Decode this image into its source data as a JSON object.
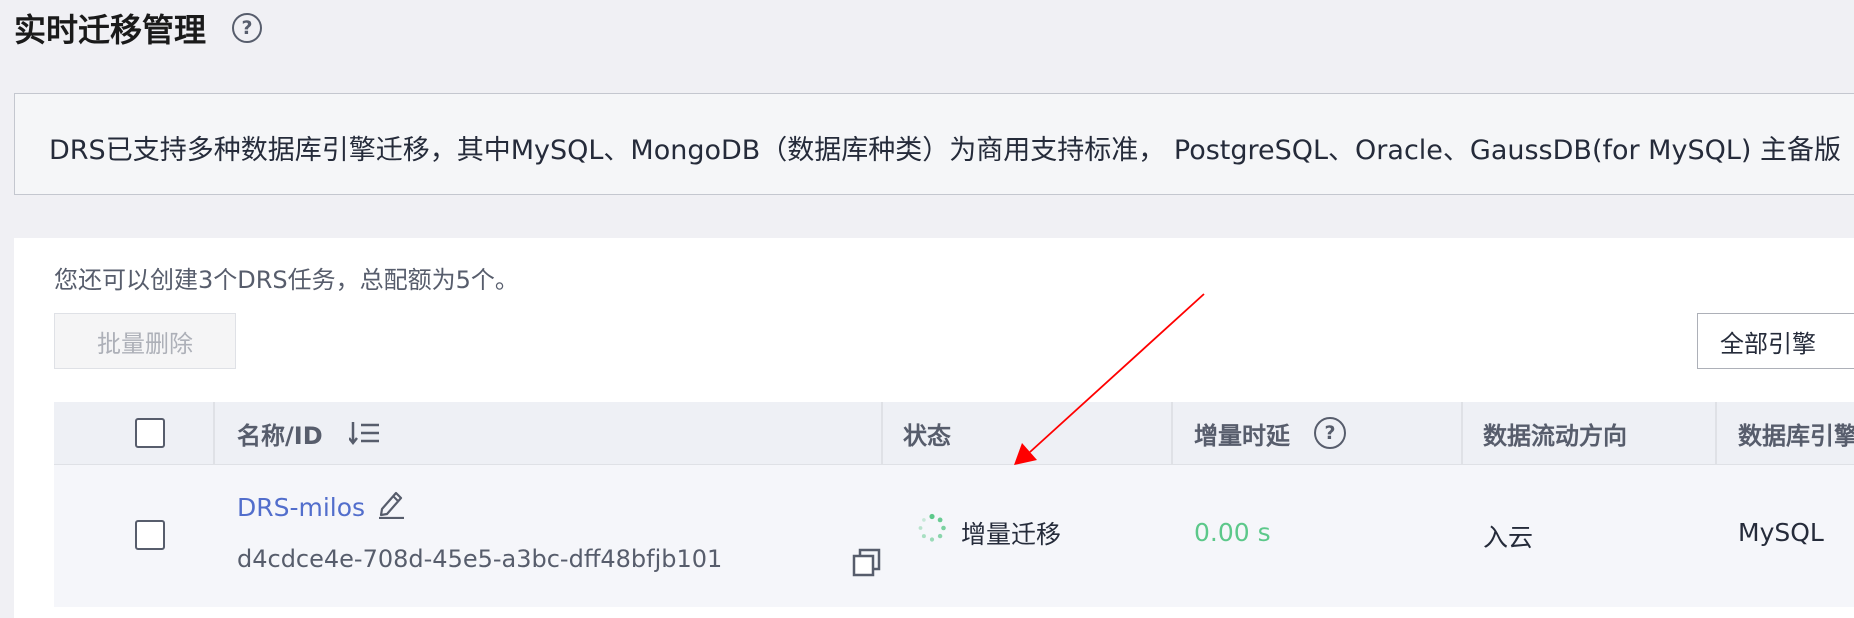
{
  "page": {
    "title": "实时迁移管理",
    "notice": "DRS已支持多种数据库引擎迁移，其中MySQL、MongoDB（数据库种类）为商用支持标准， PostgreSQL、Oracle、GaussDB(for MySQL) 主备版"
  },
  "toolbar": {
    "quota_text": "您还可以创建3个DRS任务，总配额为5个。",
    "batch_delete_label": "批量删除",
    "engine_filter_value": "全部引擎"
  },
  "table": {
    "headers": {
      "name_id": "名称/ID",
      "status": "状态",
      "incremental_delay": "增量时延",
      "data_flow_direction": "数据流动方向",
      "database_engine": "数据库引擎"
    },
    "rows": [
      {
        "name": "DRS-milos",
        "id": "d4cdce4e-708d-45e5-a3bc-dff48bfjb101",
        "status": "增量迁移",
        "incremental_delay": "0.00 s",
        "data_flow_direction": "入云",
        "database_engine": "MySQL"
      }
    ]
  },
  "icons": {
    "title_help": "help-circle-icon",
    "sort": "sort-descending-icon",
    "delay_help": "help-circle-icon",
    "edit": "pencil-icon",
    "copy": "copy-icon",
    "status": "loading-spinner-icon"
  },
  "colors": {
    "link": "#526ecc",
    "success": "#5cc88a",
    "annotation": "#ff0000",
    "table_header_bg": "#eef0f5"
  }
}
